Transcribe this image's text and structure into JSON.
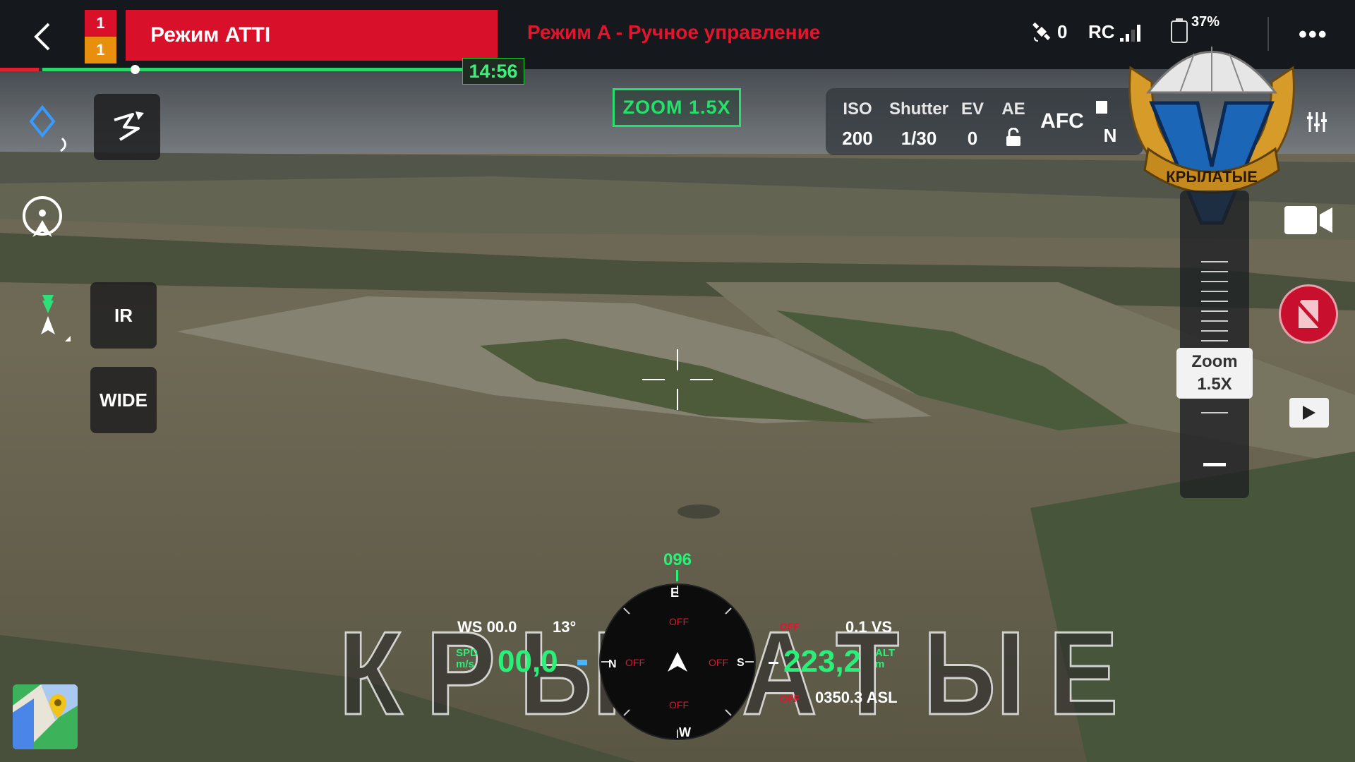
{
  "header": {
    "back_label": "‹",
    "mode_index_top": "1",
    "mode_index_bottom": "1",
    "flight_mode": "Режим ATTI",
    "control_mode": "Режим A - Ручное управление",
    "flight_time": "14:56",
    "satellites_count": "0",
    "rc_label": "RC",
    "battery_percent": "37%",
    "more_label": "•••"
  },
  "left_controls": {
    "ir_label": "IR",
    "wide_label": "WIDE"
  },
  "zoom_indicator": "ZOOM  1.5X",
  "camera": {
    "iso_label": "ISO",
    "iso_value": "200",
    "shutter_label": "Shutter",
    "shutter_value": "1/30",
    "ev_label": "EV",
    "ev_value": "0",
    "ae_label": "AE",
    "focus_mode": "AFC",
    "storage_label": "N"
  },
  "zoom_rail": {
    "label": "Zoom",
    "value": "1.5X",
    "minus_label": "—"
  },
  "hud": {
    "heading": "096",
    "ws_label": "WS",
    "ws_value": "00.0",
    "ws_extra": "13°",
    "speed_label_1": "SPD",
    "speed_label_2": "m/s",
    "speed_value": "00,0",
    "alt_value": "223,2",
    "alt_label_1": "ALT",
    "alt_label_2": "m",
    "vs_value": "0.1",
    "vs_label": "VS",
    "asl_value": "0350.3",
    "asl_label": "ASL",
    "off_top": "OFF",
    "off_left": "OFF",
    "off_right": "OFF",
    "off_bottom": "OFF",
    "off_small_1": "OFF",
    "off_small_2": "OFF",
    "compass_e": "E",
    "compass_w": "W",
    "compass_n": "N",
    "compass_s": "S"
  },
  "overlay_text": "КРЫЛАТЫЕ",
  "logo_text": "КРЫЛАТЫЕ",
  "colors": {
    "accent_red": "#d8102a",
    "accent_orange": "#e8900e",
    "hud_green": "#2af079",
    "top_bar": "#15181c"
  },
  "icons": {
    "back": "chevron-left-icon",
    "ai_track": "route-icon",
    "gps": "satellite-icon",
    "rc_signal": "signal-bars-icon",
    "battery": "battery-icon",
    "video": "video-camera-icon",
    "record": "record-icon",
    "playback": "play-icon",
    "map": "map-icon"
  }
}
